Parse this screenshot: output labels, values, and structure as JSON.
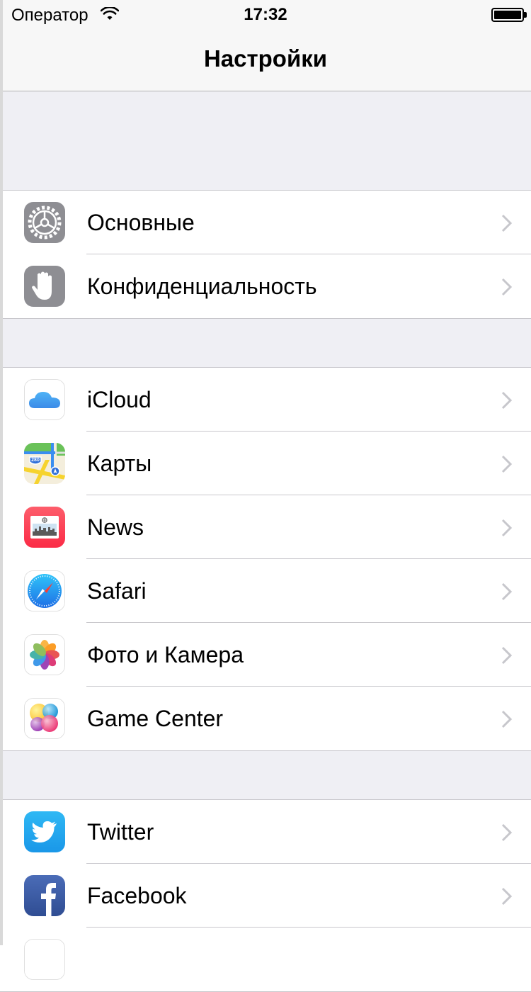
{
  "status_bar": {
    "carrier": "Оператор",
    "time": "17:32",
    "wifi_icon": "wifi-icon",
    "battery_icon": "battery-icon",
    "battery_level": 1.0
  },
  "nav": {
    "title": "Настройки"
  },
  "groups": [
    {
      "items": [
        {
          "label": "Основные",
          "icon": "gear-icon"
        },
        {
          "label": "Конфиденциальность",
          "icon": "hand-icon"
        }
      ]
    },
    {
      "items": [
        {
          "label": "iCloud",
          "icon": "icloud-icon"
        },
        {
          "label": "Карты",
          "icon": "maps-icon"
        },
        {
          "label": "News",
          "icon": "news-icon"
        },
        {
          "label": "Safari",
          "icon": "safari-icon"
        },
        {
          "label": "Фото и Камера",
          "icon": "photos-icon"
        },
        {
          "label": "Game Center",
          "icon": "game-center-icon"
        }
      ]
    },
    {
      "items": [
        {
          "label": "Twitter",
          "icon": "twitter-icon"
        },
        {
          "label": "Facebook",
          "icon": "facebook-icon"
        },
        {
          "label": "",
          "icon": "app-icon"
        }
      ]
    }
  ],
  "icons": {
    "maps_shield": "280"
  },
  "colors": {
    "background": "#efeff4",
    "separator": "#c8c7cc",
    "chevron": "#c7c7cc",
    "settings_gray": "#8e8e93",
    "news_red": "#fc3d4c",
    "twitter_blue": "#1da1f2",
    "facebook_blue": "#3b5998"
  }
}
